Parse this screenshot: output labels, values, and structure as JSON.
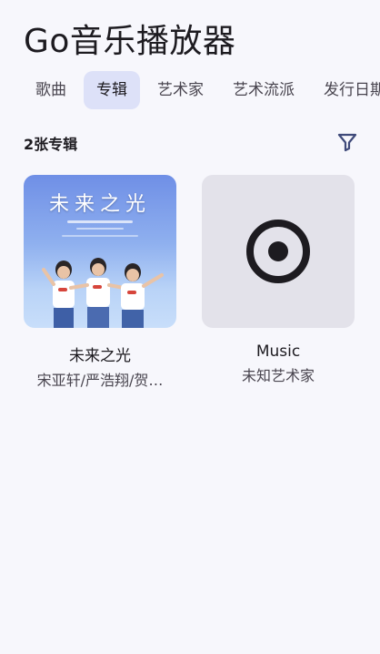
{
  "app": {
    "title": "Go音乐播放器"
  },
  "tabs": [
    {
      "label": "歌曲",
      "active": false
    },
    {
      "label": "专辑",
      "active": true
    },
    {
      "label": "艺术家",
      "active": false
    },
    {
      "label": "艺术流派",
      "active": false
    },
    {
      "label": "发行日期",
      "active": false
    }
  ],
  "albums_header": {
    "count_text": "2张专辑",
    "filter_icon": "filter-icon"
  },
  "albums": [
    {
      "title": "未来之光",
      "artist": "宋亚轩/严浩翔/贺…",
      "cover_text": "未来之光"
    },
    {
      "title": "Music",
      "artist": "未知艺术家",
      "placeholder_icon": "album-disc-icon"
    }
  ],
  "colors": {
    "background": "#f7f7fc",
    "active_tab": "#dde1f8",
    "filter_icon": "#3f4a7a",
    "placeholder_bg": "#e3e2ea"
  }
}
